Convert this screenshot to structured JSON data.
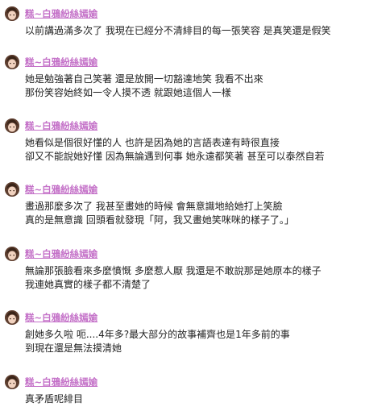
{
  "author_name": "糕~白鴉紛絲嫣媮",
  "author_color": "#c471c8",
  "posts": [
    {
      "lines": [
        "以前講過滿多次了 我現在已經分不清緋目的每一張笑容 是真笑還是假笑"
      ]
    },
    {
      "lines": [
        "她是勉強著自己笑著 還是放開一切豁達地笑 我看不出來",
        "那份笑容始終如一令人摸不透 就跟她這個人一樣"
      ]
    },
    {
      "lines": [
        "她看似是個很好懂的人 也許是因為她的言語表達有時很直接",
        "卻又不能說她好懂 因為無論遇到何事 她永遠都笑著 甚至可以泰然自若"
      ]
    },
    {
      "lines": [
        "畫過那麼多次了 我甚至畫她的時候 會無意識地給她打上笑臉",
        "真的是無意識 回頭看就發現「阿，我又畫她笑咪咪的樣子了。」"
      ]
    },
    {
      "lines": [
        "無論那張臉看來多麼憤慨 多麼惹人厭 我還是不敢說那是她原本的樣子",
        "我連她真實的樣子都不清楚了"
      ]
    },
    {
      "lines": [
        "創她多久啦 呃....4年多?最大部分的故事補齊也是1年多前的事",
        "到現在還是無法摸清她"
      ]
    },
    {
      "lines": [
        "真矛盾呢緋目"
      ]
    }
  ]
}
